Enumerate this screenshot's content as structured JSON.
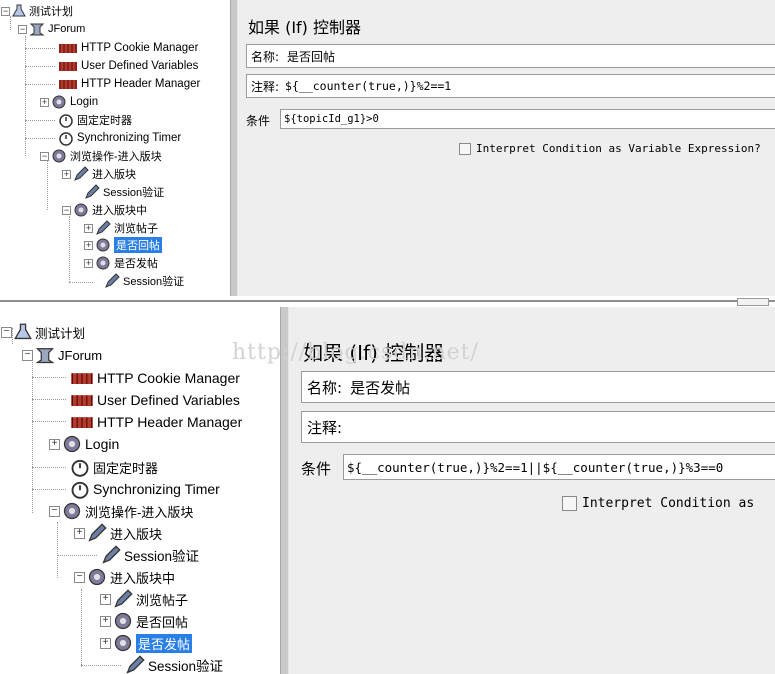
{
  "top": {
    "tree": {
      "test_plan": "测试计划",
      "thread_group": "JForum",
      "cookie_manager": "HTTP Cookie Manager",
      "user_vars": "User Defined Variables",
      "header_manager": "HTTP Header Manager",
      "login": "Login",
      "const_timer": "固定定时器",
      "sync_timer": "Synchronizing Timer",
      "browse_op": "浏览操作-进入版块",
      "enter_board": "进入版块",
      "session_check": "Session验证",
      "in_board": "进入版块中",
      "browse_post": "浏览帖子",
      "reply_ctrl": "是否回帖",
      "post_ctrl": "是否发帖",
      "session_check2": "Session验证"
    },
    "panel": {
      "title": "如果 (If) 控制器",
      "name_label": "名称:",
      "name_value": "是否回帖",
      "comment_label": "注释:",
      "comment_value": "${__counter(true,)}%2==1",
      "condition_label": "条件",
      "condition_value": "${topicId_g1}>0",
      "checkbox_label": "Interpret Condition as Variable Expression?"
    }
  },
  "bottom": {
    "tree": {
      "test_plan": "测试计划",
      "thread_group": "JForum",
      "cookie_manager": "HTTP Cookie Manager",
      "user_vars": "User Defined Variables",
      "header_manager": "HTTP Header Manager",
      "login": "Login",
      "const_timer": "固定定时器",
      "sync_timer": "Synchronizing Timer",
      "browse_op": "浏览操作-进入版块",
      "enter_board": "进入版块",
      "session_check": "Session验证",
      "in_board": "进入版块中",
      "browse_post": "浏览帖子",
      "reply_ctrl": "是否回帖",
      "post_ctrl": "是否发帖",
      "session_check2": "Session验证"
    },
    "panel": {
      "title": "如果 (If) 控制器",
      "name_label": "名称:",
      "name_value": "是否发帖",
      "comment_label": "注释:",
      "comment_value": "",
      "condition_label": "条件",
      "condition_value": "${__counter(true,)}%2==1||${__counter(true,)}%3==0",
      "checkbox_label": "Interpret Condition as"
    },
    "watermark": "http://blog.csdn.net/"
  },
  "colors": {
    "selection": "#2a7fe6",
    "panel_bg": "#eeeeee",
    "field_border": "#9b9b9b"
  },
  "icons": {
    "test_plan": "flask-icon",
    "thread_group": "spool-icon",
    "config": "scales-icon",
    "controller": "gear-cog-icon",
    "timer": "stopwatch-icon",
    "sampler": "pencil-icon"
  }
}
